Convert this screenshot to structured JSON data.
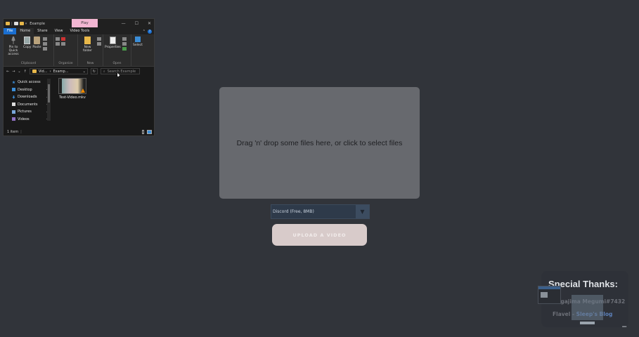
{
  "explorer": {
    "title": "Example",
    "context_tab": "Play",
    "ribbon_tabs": [
      "File",
      "Home",
      "Share",
      "View",
      "Video Tools"
    ],
    "ribbon": {
      "clipboard": {
        "pin_label": "Pin to Quick access",
        "copy_label": "Copy",
        "paste_label": "Paste",
        "group_label": "Clipboard"
      },
      "organize": {
        "group_label": "Organize"
      },
      "new": {
        "new_folder_label": "New folder",
        "group_label": "New"
      },
      "open": {
        "properties_label": "Properties",
        "group_label": "Open"
      },
      "select": {
        "select_label": "Select"
      }
    },
    "address": {
      "segment1": "Vid...",
      "segment2": "Examp...",
      "search_placeholder": "Search Example"
    },
    "nav_items": [
      {
        "label": "Quick access",
        "icon": "star-icon"
      },
      {
        "label": "Desktop",
        "icon": "desktop-icon"
      },
      {
        "label": "Downloads",
        "icon": "download-icon"
      },
      {
        "label": "Documents",
        "icon": "documents-icon"
      },
      {
        "label": "Pictures",
        "icon": "pictures-icon"
      },
      {
        "label": "Videos",
        "icon": "videos-icon"
      }
    ],
    "file": {
      "name": "Test-Video.mkv"
    },
    "status": "1 item"
  },
  "app": {
    "dropzone_text": "Drag 'n' drop some files here, or click to select files",
    "select_value": "Discord (Free, 8MB)",
    "upload_label": "UPLOAD A VIDEO"
  },
  "thanks": {
    "title": "Special Thanks:",
    "name1": "Nagajima Megumi#7432",
    "name2_prefix": "Flavel",
    "name2_link": "Sleep's Blog"
  }
}
